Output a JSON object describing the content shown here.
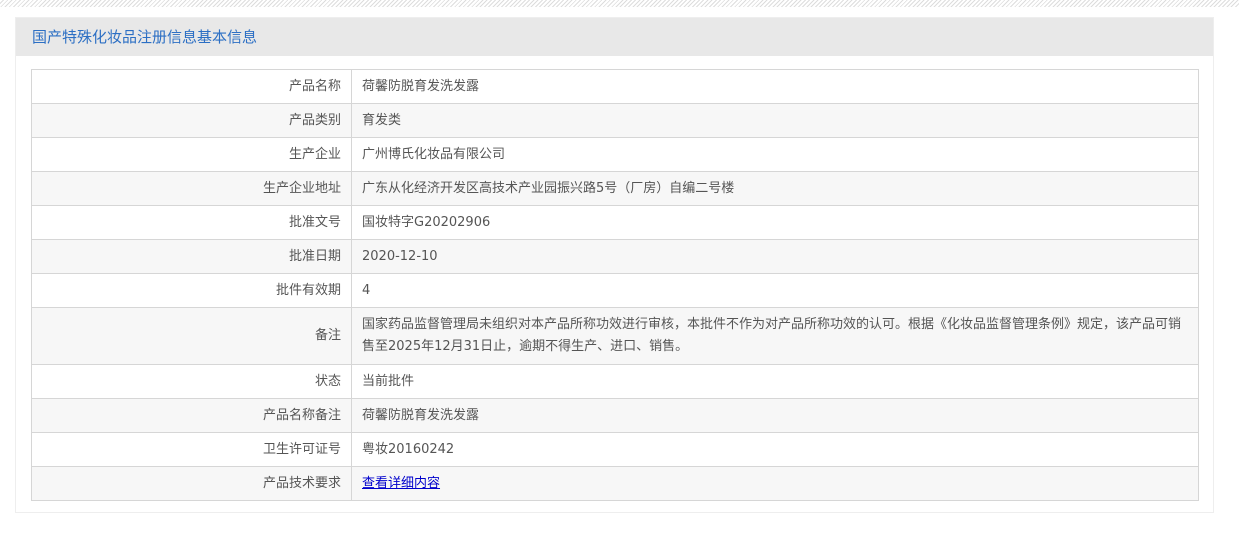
{
  "title": "国产特殊化妆品注册信息基本信息",
  "rows": [
    {
      "label": "产品名称",
      "value": "荷馨防脱育发洗发露"
    },
    {
      "label": "产品类别",
      "value": "育发类"
    },
    {
      "label": "生产企业",
      "value": "广州博氏化妆品有限公司"
    },
    {
      "label": "生产企业地址",
      "value": "广东从化经济开发区高技术产业园振兴路5号（厂房）自编二号楼"
    },
    {
      "label": "批准文号",
      "value": "国妆特字G20202906"
    },
    {
      "label": "批准日期",
      "value": "2020-12-10"
    },
    {
      "label": "批件有效期",
      "value": "4"
    },
    {
      "label": "备注",
      "value": "国家药品监督管理局未组织对本产品所称功效进行审核，本批件不作为对产品所称功效的认可。根据《化妆品监督管理条例》规定，该产品可销售至2025年12月31日止，逾期不得生产、进口、销售。"
    },
    {
      "label": "状态",
      "value": "当前批件"
    },
    {
      "label": "产品名称备注",
      "value": "荷馨防脱育发洗发露"
    },
    {
      "label": "卫生许可证号",
      "value": "粤妆20160242"
    },
    {
      "label": "产品技术要求",
      "value": "查看详细内容"
    }
  ]
}
